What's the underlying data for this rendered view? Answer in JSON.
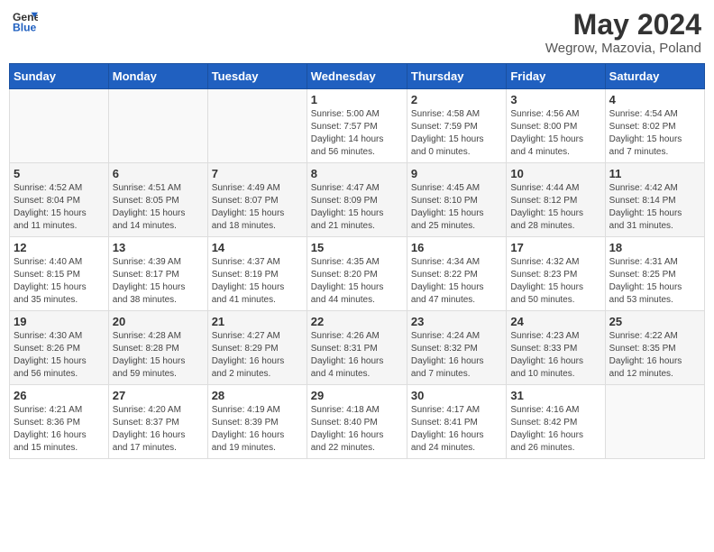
{
  "header": {
    "logo_line1": "General",
    "logo_line2": "Blue",
    "title": "May 2024",
    "subtitle": "Wegrow, Mazovia, Poland"
  },
  "days_of_week": [
    "Sunday",
    "Monday",
    "Tuesday",
    "Wednesday",
    "Thursday",
    "Friday",
    "Saturday"
  ],
  "weeks": [
    [
      {
        "day": "",
        "info": ""
      },
      {
        "day": "",
        "info": ""
      },
      {
        "day": "",
        "info": ""
      },
      {
        "day": "1",
        "info": "Sunrise: 5:00 AM\nSunset: 7:57 PM\nDaylight: 14 hours\nand 56 minutes."
      },
      {
        "day": "2",
        "info": "Sunrise: 4:58 AM\nSunset: 7:59 PM\nDaylight: 15 hours\nand 0 minutes."
      },
      {
        "day": "3",
        "info": "Sunrise: 4:56 AM\nSunset: 8:00 PM\nDaylight: 15 hours\nand 4 minutes."
      },
      {
        "day": "4",
        "info": "Sunrise: 4:54 AM\nSunset: 8:02 PM\nDaylight: 15 hours\nand 7 minutes."
      }
    ],
    [
      {
        "day": "5",
        "info": "Sunrise: 4:52 AM\nSunset: 8:04 PM\nDaylight: 15 hours\nand 11 minutes."
      },
      {
        "day": "6",
        "info": "Sunrise: 4:51 AM\nSunset: 8:05 PM\nDaylight: 15 hours\nand 14 minutes."
      },
      {
        "day": "7",
        "info": "Sunrise: 4:49 AM\nSunset: 8:07 PM\nDaylight: 15 hours\nand 18 minutes."
      },
      {
        "day": "8",
        "info": "Sunrise: 4:47 AM\nSunset: 8:09 PM\nDaylight: 15 hours\nand 21 minutes."
      },
      {
        "day": "9",
        "info": "Sunrise: 4:45 AM\nSunset: 8:10 PM\nDaylight: 15 hours\nand 25 minutes."
      },
      {
        "day": "10",
        "info": "Sunrise: 4:44 AM\nSunset: 8:12 PM\nDaylight: 15 hours\nand 28 minutes."
      },
      {
        "day": "11",
        "info": "Sunrise: 4:42 AM\nSunset: 8:14 PM\nDaylight: 15 hours\nand 31 minutes."
      }
    ],
    [
      {
        "day": "12",
        "info": "Sunrise: 4:40 AM\nSunset: 8:15 PM\nDaylight: 15 hours\nand 35 minutes."
      },
      {
        "day": "13",
        "info": "Sunrise: 4:39 AM\nSunset: 8:17 PM\nDaylight: 15 hours\nand 38 minutes."
      },
      {
        "day": "14",
        "info": "Sunrise: 4:37 AM\nSunset: 8:19 PM\nDaylight: 15 hours\nand 41 minutes."
      },
      {
        "day": "15",
        "info": "Sunrise: 4:35 AM\nSunset: 8:20 PM\nDaylight: 15 hours\nand 44 minutes."
      },
      {
        "day": "16",
        "info": "Sunrise: 4:34 AM\nSunset: 8:22 PM\nDaylight: 15 hours\nand 47 minutes."
      },
      {
        "day": "17",
        "info": "Sunrise: 4:32 AM\nSunset: 8:23 PM\nDaylight: 15 hours\nand 50 minutes."
      },
      {
        "day": "18",
        "info": "Sunrise: 4:31 AM\nSunset: 8:25 PM\nDaylight: 15 hours\nand 53 minutes."
      }
    ],
    [
      {
        "day": "19",
        "info": "Sunrise: 4:30 AM\nSunset: 8:26 PM\nDaylight: 15 hours\nand 56 minutes."
      },
      {
        "day": "20",
        "info": "Sunrise: 4:28 AM\nSunset: 8:28 PM\nDaylight: 15 hours\nand 59 minutes."
      },
      {
        "day": "21",
        "info": "Sunrise: 4:27 AM\nSunset: 8:29 PM\nDaylight: 16 hours\nand 2 minutes."
      },
      {
        "day": "22",
        "info": "Sunrise: 4:26 AM\nSunset: 8:31 PM\nDaylight: 16 hours\nand 4 minutes."
      },
      {
        "day": "23",
        "info": "Sunrise: 4:24 AM\nSunset: 8:32 PM\nDaylight: 16 hours\nand 7 minutes."
      },
      {
        "day": "24",
        "info": "Sunrise: 4:23 AM\nSunset: 8:33 PM\nDaylight: 16 hours\nand 10 minutes."
      },
      {
        "day": "25",
        "info": "Sunrise: 4:22 AM\nSunset: 8:35 PM\nDaylight: 16 hours\nand 12 minutes."
      }
    ],
    [
      {
        "day": "26",
        "info": "Sunrise: 4:21 AM\nSunset: 8:36 PM\nDaylight: 16 hours\nand 15 minutes."
      },
      {
        "day": "27",
        "info": "Sunrise: 4:20 AM\nSunset: 8:37 PM\nDaylight: 16 hours\nand 17 minutes."
      },
      {
        "day": "28",
        "info": "Sunrise: 4:19 AM\nSunset: 8:39 PM\nDaylight: 16 hours\nand 19 minutes."
      },
      {
        "day": "29",
        "info": "Sunrise: 4:18 AM\nSunset: 8:40 PM\nDaylight: 16 hours\nand 22 minutes."
      },
      {
        "day": "30",
        "info": "Sunrise: 4:17 AM\nSunset: 8:41 PM\nDaylight: 16 hours\nand 24 minutes."
      },
      {
        "day": "31",
        "info": "Sunrise: 4:16 AM\nSunset: 8:42 PM\nDaylight: 16 hours\nand 26 minutes."
      },
      {
        "day": "",
        "info": ""
      }
    ]
  ]
}
